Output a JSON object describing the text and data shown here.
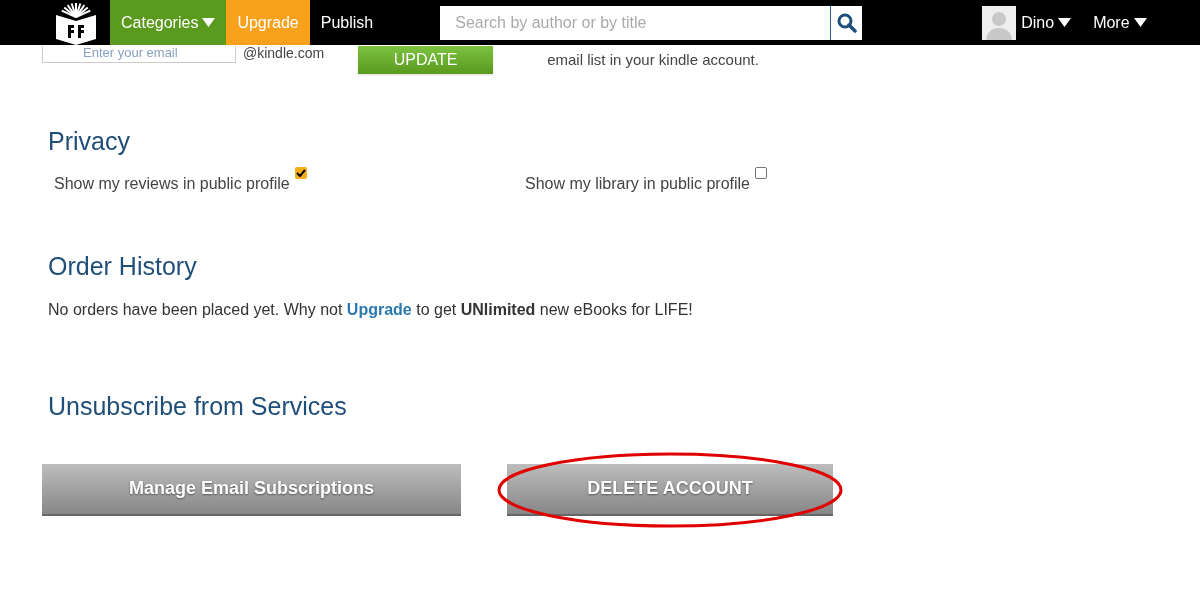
{
  "nav": {
    "items": [
      {
        "label": "Categories",
        "kind": "dropdown",
        "color": "#5a9a1e"
      },
      {
        "label": "Upgrade",
        "kind": "link",
        "color": "#f9a11b"
      },
      {
        "label": "Publish",
        "kind": "link",
        "color": "#000000"
      }
    ],
    "search": {
      "placeholder": "Search by author or by title"
    },
    "user": {
      "name": "Dino"
    },
    "more": "More"
  },
  "kindle": {
    "placeholder": "Enter your email",
    "suffix": "@kindle.com",
    "button": "UPDATE",
    "note": "email list in your kindle account."
  },
  "privacy": {
    "title": "Privacy",
    "options": [
      {
        "label": "Show my reviews in public profile",
        "checked": true
      },
      {
        "label": "Show my library in public profile",
        "checked": false
      }
    ]
  },
  "orders": {
    "title": "Order History",
    "message_start": "No orders have been placed yet. Why not ",
    "link": "Upgrade",
    "message_end": " to get **UNlimited** new eBooks for LIFE!"
  },
  "unsubscribe": {
    "title": "Unsubscribe from Services",
    "buttons": [
      {
        "label": "Manage Email Subscriptions",
        "highlighted": false
      },
      {
        "label": "DELETE ACCOUNT",
        "highlighted": true
      }
    ]
  }
}
